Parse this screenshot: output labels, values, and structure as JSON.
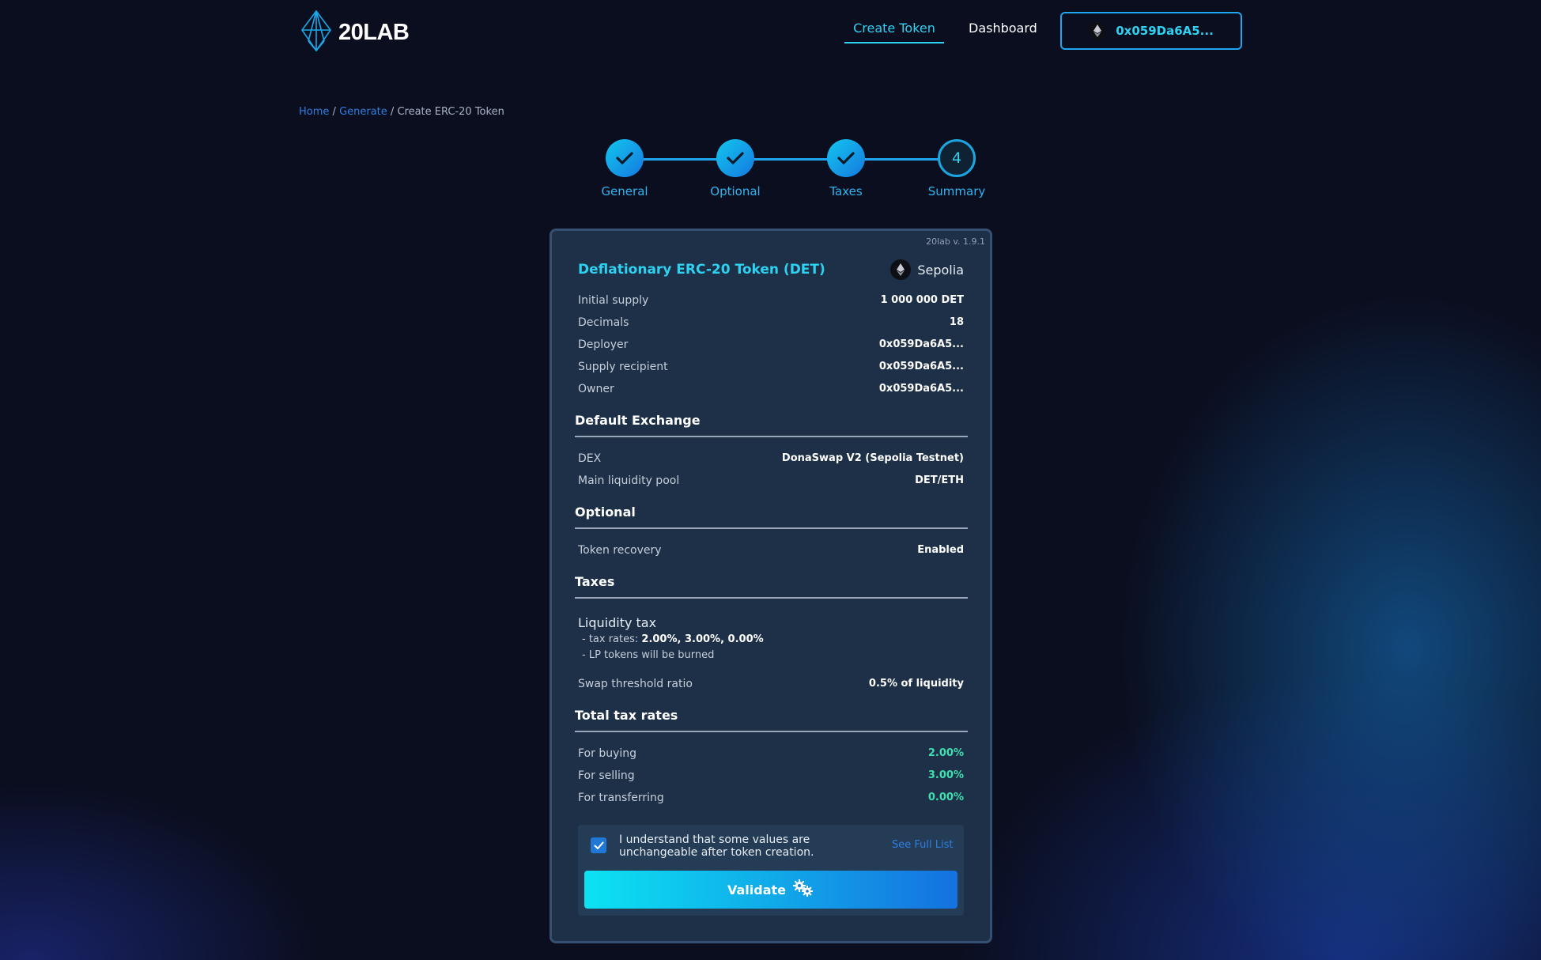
{
  "header": {
    "logo_text": "20LAB",
    "nav": [
      {
        "label": "Create Token",
        "active": true
      },
      {
        "label": "Dashboard",
        "active": false
      }
    ],
    "wallet": {
      "address": "0x059Da6A5...",
      "icon": "ethereum-icon"
    }
  },
  "breadcrumb": {
    "items": [
      "Home",
      "Generate"
    ],
    "separator": "/",
    "current": "Create ERC-20 Token"
  },
  "stepper": {
    "steps": [
      {
        "label": "General",
        "state": "done",
        "icon": "check-icon"
      },
      {
        "label": "Optional",
        "state": "done",
        "icon": "check-icon"
      },
      {
        "label": "Taxes",
        "state": "done",
        "icon": "check-icon"
      },
      {
        "label": "Summary",
        "state": "current",
        "number": "4"
      }
    ]
  },
  "summary": {
    "version": "20lab v. 1.9.1",
    "title": "Deflationary ERC-20 Token (DET)",
    "network": "Sepolia",
    "general": [
      {
        "label": "Initial supply",
        "value": "1 000 000 DET"
      },
      {
        "label": "Decimals",
        "value": "18"
      },
      {
        "label": "Deployer",
        "value": "0x059Da6A5..."
      },
      {
        "label": "Supply recipient",
        "value": "0x059Da6A5..."
      },
      {
        "label": "Owner",
        "value": "0x059Da6A5..."
      }
    ],
    "exchange": {
      "heading": "Default Exchange",
      "rows": [
        {
          "label": "DEX",
          "value": "DonaSwap V2 (Sepolia Testnet)"
        },
        {
          "label": "Main liquidity pool",
          "value": "DET/ETH"
        }
      ]
    },
    "optional": {
      "heading": "Optional",
      "rows": [
        {
          "label": "Token recovery",
          "value": "Enabled"
        }
      ]
    },
    "taxes": {
      "heading": "Taxes",
      "liquidity_title": "Liquidity tax",
      "tax_rates_prefix": "- tax rates: ",
      "tax_rates_value": "2.00%, 3.00%, 0.00%",
      "lp_note": "- LP tokens will be burned",
      "threshold_label": "Swap threshold ratio",
      "threshold_value": "0.5% of liquidity"
    },
    "totals": {
      "heading": "Total tax rates",
      "rows": [
        {
          "label": "For buying",
          "value": "2.00%"
        },
        {
          "label": "For selling",
          "value": "3.00%"
        },
        {
          "label": "For transferring",
          "value": "0.00%"
        }
      ]
    },
    "consent": {
      "checked": true,
      "text": "I understand that some values are unchangeable after token creation.",
      "link": "See Full List"
    },
    "validate_label": "Validate",
    "validate_icon": "gears-icon"
  },
  "colors": {
    "accent": "#2fd1f0",
    "link": "#2f7fe0",
    "positive": "#3fe0b0",
    "card_bg": "#1d3047",
    "page_bg": "#0b0e1f"
  }
}
